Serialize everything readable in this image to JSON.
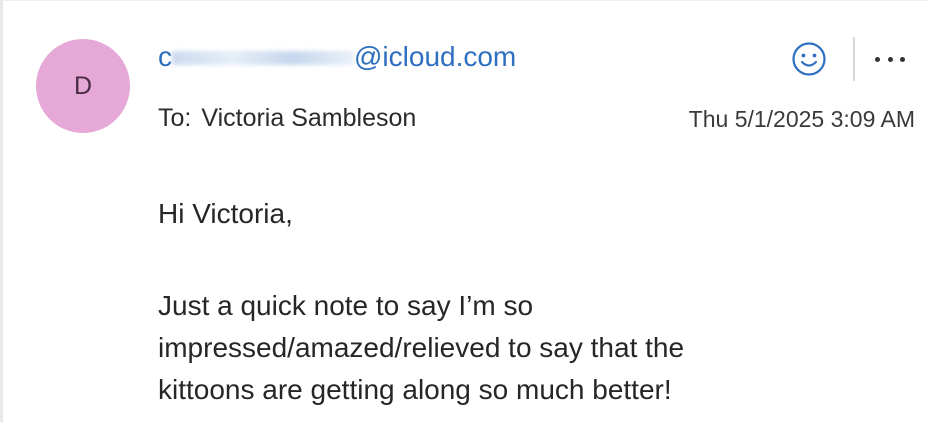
{
  "sender": {
    "avatar_initial": "D",
    "avatar_color": "#e6a8d6",
    "email_start": "c",
    "email_end": "@icloud.com",
    "color": "#2f6fbf"
  },
  "recipient": {
    "label": "To:",
    "name": "Victoria Sambleson"
  },
  "timestamp": "Thu 5/1/2025 3:09 AM",
  "actions": {
    "emoji_icon": "smiley-icon",
    "more_icon": "more-options-icon"
  },
  "message": {
    "greeting": "Hi Victoria,",
    "lines": [
      "Just a quick note to say I’m so",
      "impressed/amazed/relieved to say that the",
      "kittoons are getting along so much better!"
    ]
  }
}
